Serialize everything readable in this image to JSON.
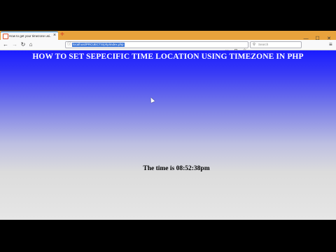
{
  "browser": {
    "tab": {
      "title": "How to get your timezone usi...",
      "close_glyph": "×"
    },
    "new_tab_glyph": "+",
    "window_controls": {
      "minimize": "—",
      "maximize": "☐",
      "close": "✕"
    },
    "nav": {
      "back_glyph": "←",
      "forward_glyph": "→",
      "reload_glyph": "↻",
      "home_glyph": "⌂"
    },
    "url": {
      "value": "localhost/PROJECTS/php/index.php",
      "info_glyph": "ⓘ",
      "more_glyph": "···",
      "pocket_glyph": "◘",
      "bookmark_glyph": "☆"
    },
    "search": {
      "icon_glyph": "⚲",
      "placeholder": "Search"
    },
    "menu_glyph": "≡"
  },
  "page": {
    "heading": "HOW TO SET SEPECIFIC TIME LOCATION USING TIMEZONE IN PHP",
    "time_text": "The time is 08:52:38pm"
  },
  "colors": {
    "tabbar": "#e8a23c",
    "page_gradient_top": "#1a1cff",
    "page_gradient_bottom": "#e6e6e6",
    "url_selection": "#3b76d8"
  }
}
